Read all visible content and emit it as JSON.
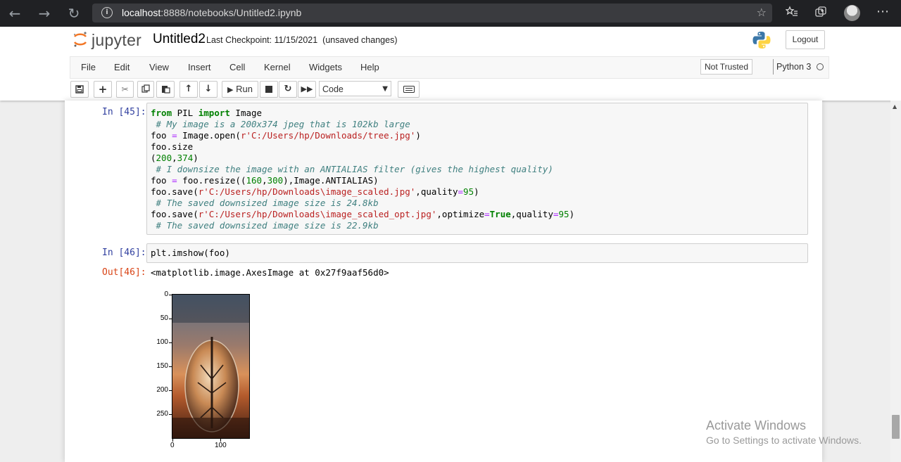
{
  "browser": {
    "back_icon": "←",
    "forward_icon": "→",
    "reload_icon": "↻",
    "url_host": "localhost",
    "url_rest": ":8888/notebooks/Untitled2.ipynb",
    "info_icon": "i",
    "fav_icon": "☆",
    "more_icon": "⋯"
  },
  "jupyter": {
    "logo_text": "jupyter",
    "notebook_name": "Untitled2",
    "checkpoint_text": "Last Checkpoint: 11/15/2021  (unsaved changes)",
    "logout_label": "Logout",
    "menu": [
      "File",
      "Edit",
      "View",
      "Insert",
      "Cell",
      "Kernel",
      "Widgets",
      "Help"
    ],
    "trust_label": "Not Trusted",
    "kernel_name": "Python 3",
    "run_label": "Run",
    "cell_type": "Code"
  },
  "cells": {
    "cell1_prompt": "In [45]:",
    "cell2_prompt": "In [46]:",
    "cell2_code": "plt.imshow(foo)",
    "out_prompt": "Out[46]:",
    "out_text": "<matplotlib.image.AxesImage at 0x27f9aaf56d0>"
  },
  "code_lines": [
    "from PIL import Image",
    " # My image is a 200x374 jpeg that is 102kb large",
    "foo = Image.open(r'C:/Users/hp/Downloads/tree.jpg')",
    "foo.size",
    "(200,374)",
    " # I downsize the image with an ANTIALIAS filter (gives the highest quality)",
    "foo = foo.resize((160,300),Image.ANTIALIAS)",
    "foo.save(r'C:/Users/hp/Downloads\\image_scaled.jpg',quality=95)",
    " # The saved downsized image size is 24.8kb",
    "foo.save(r'C:/Users/hp/Downloads\\image_scaled_opt.jpg',optimize=True,quality=95)",
    " # The saved downsized image size is 22.9kb"
  ],
  "plot": {
    "y_ticks": [
      "0",
      "50",
      "100",
      "150",
      "200",
      "250"
    ],
    "x_ticks": [
      "0",
      "100"
    ]
  },
  "watermark": {
    "title": "Activate Windows",
    "subtitle": "Go to Settings to activate Windows."
  }
}
